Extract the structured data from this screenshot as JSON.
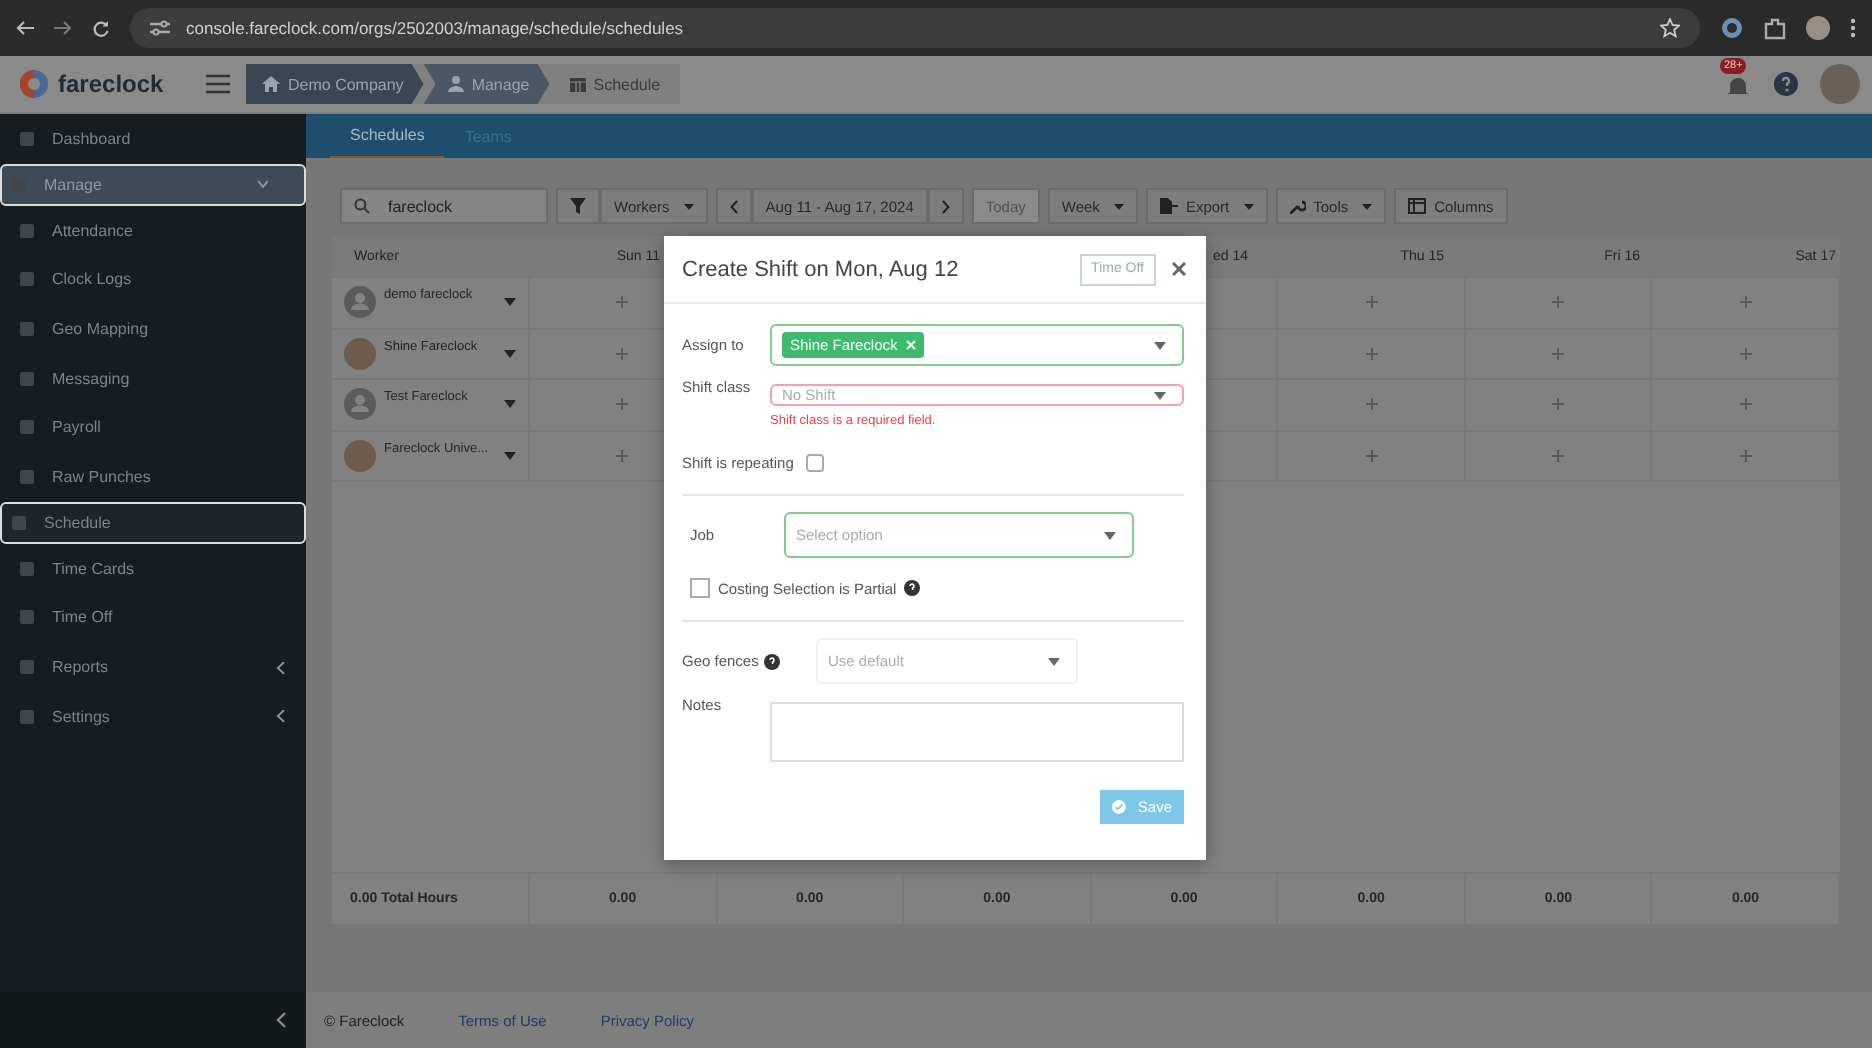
{
  "browser": {
    "url": "console.fareclock.com/orgs/2502003/manage/schedule/schedules"
  },
  "header": {
    "logo": "fareclock",
    "breadcrumbs": [
      {
        "label": "Demo Company",
        "kind": "home"
      },
      {
        "label": "Manage",
        "kind": "user"
      },
      {
        "label": "Schedule",
        "kind": "calendar"
      }
    ],
    "notification_badge": "28+"
  },
  "sidebar": {
    "items": [
      {
        "label": "Dashboard",
        "selected": false,
        "expandable": false
      },
      {
        "label": "Manage",
        "selected": true,
        "expandable": true
      },
      {
        "label": "Attendance",
        "selected": false,
        "expandable": false
      },
      {
        "label": "Clock Logs",
        "selected": false,
        "expandable": false
      },
      {
        "label": "Geo Mapping",
        "selected": false,
        "expandable": false
      },
      {
        "label": "Messaging",
        "selected": false,
        "expandable": false
      },
      {
        "label": "Payroll",
        "selected": false,
        "expandable": false
      },
      {
        "label": "Raw Punches",
        "selected": false,
        "expandable": false
      },
      {
        "label": "Schedule",
        "selected": true,
        "expandable": false
      },
      {
        "label": "Time Cards",
        "selected": false,
        "expandable": false
      },
      {
        "label": "Time Off",
        "selected": false,
        "expandable": false
      },
      {
        "label": "Reports",
        "selected": false,
        "expandable": true
      },
      {
        "label": "Settings",
        "selected": false,
        "expandable": true
      }
    ]
  },
  "tabs": [
    {
      "label": "Schedules",
      "selected": true
    },
    {
      "label": "Teams",
      "selected": false
    }
  ],
  "toolbar": {
    "search": "fareclock",
    "workers": "Workers",
    "date_range": "Aug 11 - Aug 17, 2024",
    "today": {
      "label": "Today",
      "disabled": true
    },
    "week": "Week",
    "export": "Export",
    "tools": "Tools",
    "columns": "Columns"
  },
  "table": {
    "worker_heading": "Worker",
    "day_columns": [
      {
        "label": "Sun 11"
      },
      {},
      {},
      {
        "label": "ed 14"
      },
      {
        "label": "Thu 15"
      },
      {
        "label": "Fri 16"
      },
      {
        "label": "Sat 17"
      }
    ],
    "rows": [
      {
        "name": "demo fareclock",
        "photo": false
      },
      {
        "name": "Shine Fareclock",
        "photo": true
      },
      {
        "name": "Test Fareclock",
        "photo": false
      },
      {
        "name": "Fareclock Unive...",
        "photo": true
      }
    ],
    "total_label": "0.00 Total Hours",
    "totals": [
      "0.00",
      "0.00",
      "0.00",
      "0.00",
      "0.00",
      "0.00",
      "0.00"
    ]
  },
  "footer": {
    "copyright": "© Fareclock",
    "links": [
      "Terms of Use",
      "Privacy Policy"
    ]
  },
  "dialog": {
    "title": "Create Shift on Mon, Aug 12",
    "time_off_button": "Time Off",
    "assign_to": {
      "label": "Assign to",
      "tags": [
        "Shine Fareclock"
      ]
    },
    "shift_class": {
      "label": "Shift class",
      "placeholder": "No Shift",
      "error": "Shift class is a required field."
    },
    "repeating": {
      "label": "Shift is repeating",
      "checked": false
    },
    "job": {
      "label": "Job",
      "placeholder": "Select option"
    },
    "costing": {
      "label": "Costing Selection is Partial",
      "checked": false
    },
    "geo_fences": {
      "label": "Geo fences",
      "placeholder": "Use default"
    },
    "notes": {
      "label": "Notes"
    },
    "save": {
      "label": "Save",
      "disabled": true
    }
  }
}
